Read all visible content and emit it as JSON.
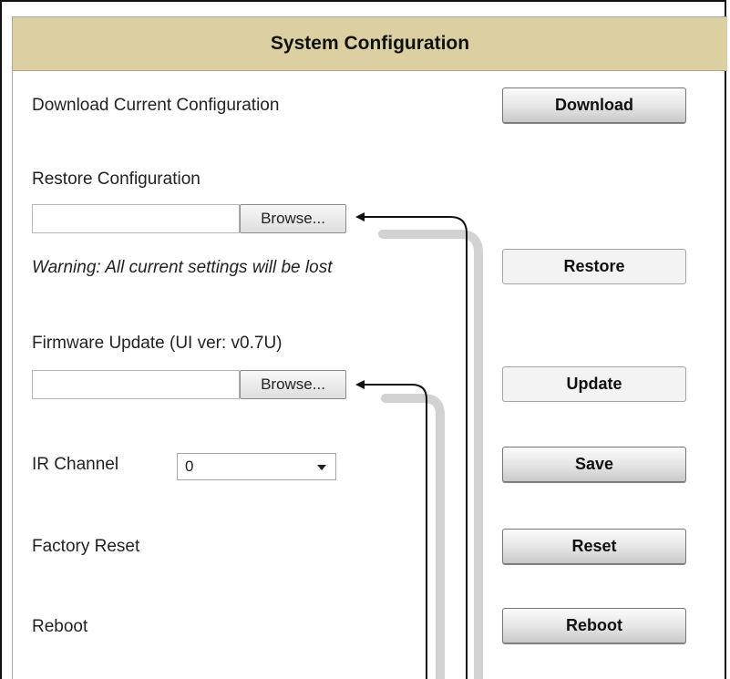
{
  "title": "System Configuration",
  "download": {
    "label": "Download Current Configuration",
    "button": "Download"
  },
  "restore": {
    "label": "Restore Configuration",
    "file_value": "",
    "browse": "Browse...",
    "warning": "Warning: All current settings will be lost",
    "button": "Restore"
  },
  "firmware": {
    "label": "Firmware Update (UI ver: v0.7U)",
    "file_value": "",
    "browse": "Browse...",
    "button": "Update"
  },
  "ir": {
    "label": "IR Channel",
    "selected": "0",
    "button": "Save"
  },
  "factory_reset": {
    "label": "Factory Reset",
    "button": "Reset"
  },
  "reboot": {
    "label": "Reboot",
    "button": "Reboot"
  },
  "colors": {
    "title_bg": "#dccfa2",
    "callout_line": "#111111",
    "callout_shadow": "#d2d2d2"
  }
}
